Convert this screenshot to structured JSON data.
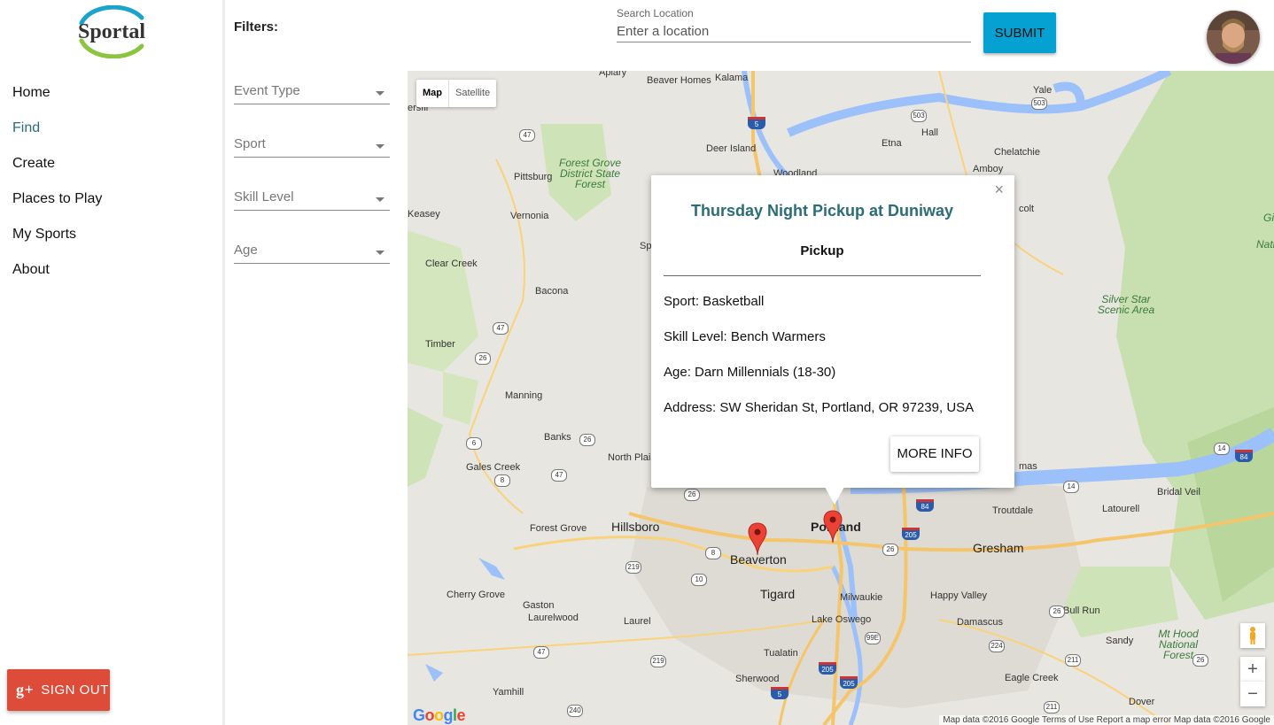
{
  "app": {
    "logo_text": "Sportal"
  },
  "sidebar": {
    "items": [
      {
        "label": "Home"
      },
      {
        "label": "Find"
      },
      {
        "label": "Create"
      },
      {
        "label": "Places to Play"
      },
      {
        "label": "My Sports"
      },
      {
        "label": "About"
      }
    ],
    "active": "Find",
    "signout_label": "SIGN OUT",
    "signout_icon": "g+"
  },
  "filters": {
    "title": "Filters:",
    "selects": [
      {
        "label": "Event Type"
      },
      {
        "label": "Sport"
      },
      {
        "label": "Skill Level"
      },
      {
        "label": "Age"
      }
    ]
  },
  "search": {
    "label": "Search Location",
    "placeholder": "Enter a location",
    "value": ""
  },
  "submit_label": "SUBMIT",
  "map": {
    "type_buttons": [
      "Map",
      "Satellite"
    ],
    "selected_type": "Map",
    "zoom_in": "+",
    "zoom_out": "−",
    "google_logo": "Google",
    "attribution": "Map data ©2016 Google   Terms of Use   Report a map error   Map data ©2016 Google",
    "places": {
      "apiary": "Apiary",
      "kalama": "Kalama",
      "beaver_homes": "Beaver Homes",
      "yale": "Yale",
      "deer_island": "Deer Island",
      "etna": "Etna",
      "hall": "Hall",
      "amboy": "Amboy",
      "chelatchie": "Chelatchie",
      "woodland": "Woodland",
      "pittsburg": "Pittsburg",
      "forest_grove_sf": "Forest Grove District State Forest",
      "vernonia": "Vernonia",
      "keasey": "Keasey",
      "clear_creek": "Clear Creek",
      "bacona": "Bacona",
      "timber": "Timber",
      "manning": "Manning",
      "banks": "Banks",
      "north_plains": "North Plai",
      "gales_creek": "Gales Creek",
      "forest_grove": "Forest Grove",
      "hillsboro": "Hillsboro",
      "beaverton": "Beaverton",
      "portland": "Portland",
      "gresham": "Gresham",
      "troutdale": "Troutdale",
      "latourell": "Latourell",
      "bridal_veil": "Bridal Veil",
      "cherry_grove": "Cherry Grove",
      "gaston": "Gaston",
      "laurelwood": "Laurelwood",
      "laurel": "Laurel",
      "tigard": "Tigard",
      "milwaukie": "Milwaukie",
      "happy_valley": "Happy Valley",
      "lake_oswego": "Lake Oswego",
      "damascus": "Damascus",
      "bull_run": "Bull Run",
      "tualatin": "Tualatin",
      "sandy": "Sandy",
      "mt_hood": "Mt Hood National Forest",
      "sherwood": "Sherwood",
      "eagle_creek": "Eagle Creek",
      "yamhill": "Yamhill",
      "dover": "Dover",
      "silver_star": "Silver Star Scenic Area",
      "ersfill": "ersfil",
      "colt": "colt",
      "natio": "Natio",
      "gi": "Gi",
      "spr": "Sp",
      "mas": "mas"
    },
    "shields": [
      "47",
      "5",
      "503",
      "503",
      "47",
      "26",
      "6",
      "26",
      "8",
      "47",
      "26",
      "84",
      "205",
      "26",
      "219",
      "8",
      "10",
      "219",
      "26",
      "99E",
      "224",
      "211",
      "26",
      "205",
      "205",
      "5",
      "211",
      "47",
      "240",
      "14",
      "14",
      "84"
    ]
  },
  "info_window": {
    "title": "Thursday Night Pickup at Duniway",
    "type": "Pickup",
    "sport": "Sport: Basketball",
    "skill": "Skill Level: Bench Warmers",
    "age": "Age: Darn Millennials (18-30)",
    "address": "Address: SW Sheridan St, Portland, OR 97239, USA",
    "more_label": "MORE INFO",
    "close": "×"
  },
  "colors": {
    "accent": "#2a6c78",
    "submit": "#06a1d3",
    "signout": "#dd4b39",
    "marker": "#ea4335"
  }
}
